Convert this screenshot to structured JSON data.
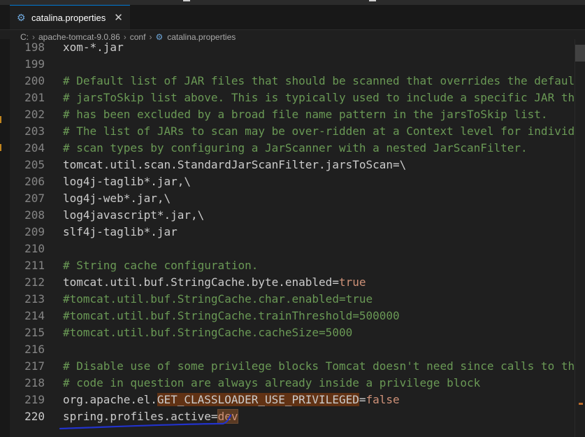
{
  "tab": {
    "title": "catalina.properties",
    "icon": "gear-icon",
    "close_label": "✕"
  },
  "breadcrumb": {
    "items": [
      "C:",
      "apache-tomcat-9.0.86",
      "conf",
      "catalina.properties"
    ]
  },
  "colors": {
    "comment": "#6a9955",
    "value": "#ce9178",
    "text": "#cccccc",
    "line_number": "#858585",
    "background": "#1f1f1f",
    "annotation": "#2233cc"
  },
  "lines": [
    {
      "n": "198",
      "text": "xom-*.jar"
    },
    {
      "n": "199",
      "text": ""
    },
    {
      "n": "200",
      "text": "# Default list of JAR files that should be scanned that overrides the default"
    },
    {
      "n": "201",
      "text": "# jarsToSkip list above. This is typically used to include a specific JAR that"
    },
    {
      "n": "202",
      "text": "# has been excluded by a broad file name pattern in the jarsToSkip list."
    },
    {
      "n": "203",
      "text": "# The list of JARs to scan may be over-ridden at a Context level for individual"
    },
    {
      "n": "204",
      "text": "# scan types by configuring a JarScanner with a nested JarScanFilter."
    },
    {
      "n": "205",
      "text": "tomcat.util.scan.StandardJarScanFilter.jarsToScan=\\"
    },
    {
      "n": "206",
      "text": "log4j-taglib*.jar,\\"
    },
    {
      "n": "207",
      "text": "log4j-web*.jar,\\"
    },
    {
      "n": "208",
      "text": "log4javascript*.jar,\\"
    },
    {
      "n": "209",
      "text": "slf4j-taglib*.jar"
    },
    {
      "n": "210",
      "text": ""
    },
    {
      "n": "211",
      "text": "# String cache configuration."
    },
    {
      "n": "212",
      "key": "tomcat.util.buf.StringCache.byte.enabled=",
      "value": "true"
    },
    {
      "n": "213",
      "text": "#tomcat.util.buf.StringCache.char.enabled=true"
    },
    {
      "n": "214",
      "text": "#tomcat.util.buf.StringCache.trainThreshold=500000"
    },
    {
      "n": "215",
      "text": "#tomcat.util.buf.StringCache.cacheSize=5000"
    },
    {
      "n": "216",
      "text": ""
    },
    {
      "n": "217",
      "text": "# Disable use of some privilege blocks Tomcat doesn't need since calls to the"
    },
    {
      "n": "218",
      "text": "# code in question are always already inside a privilege block"
    },
    {
      "n": "219",
      "key_pre": "org.apache.el.",
      "key_hl": "GET_CLASSLOADER_USE_PRIVILEGED",
      "key_post": "=",
      "value": "false"
    },
    {
      "n": "220",
      "key": "spring.profiles.active=",
      "value": "dev",
      "active": true
    }
  ]
}
